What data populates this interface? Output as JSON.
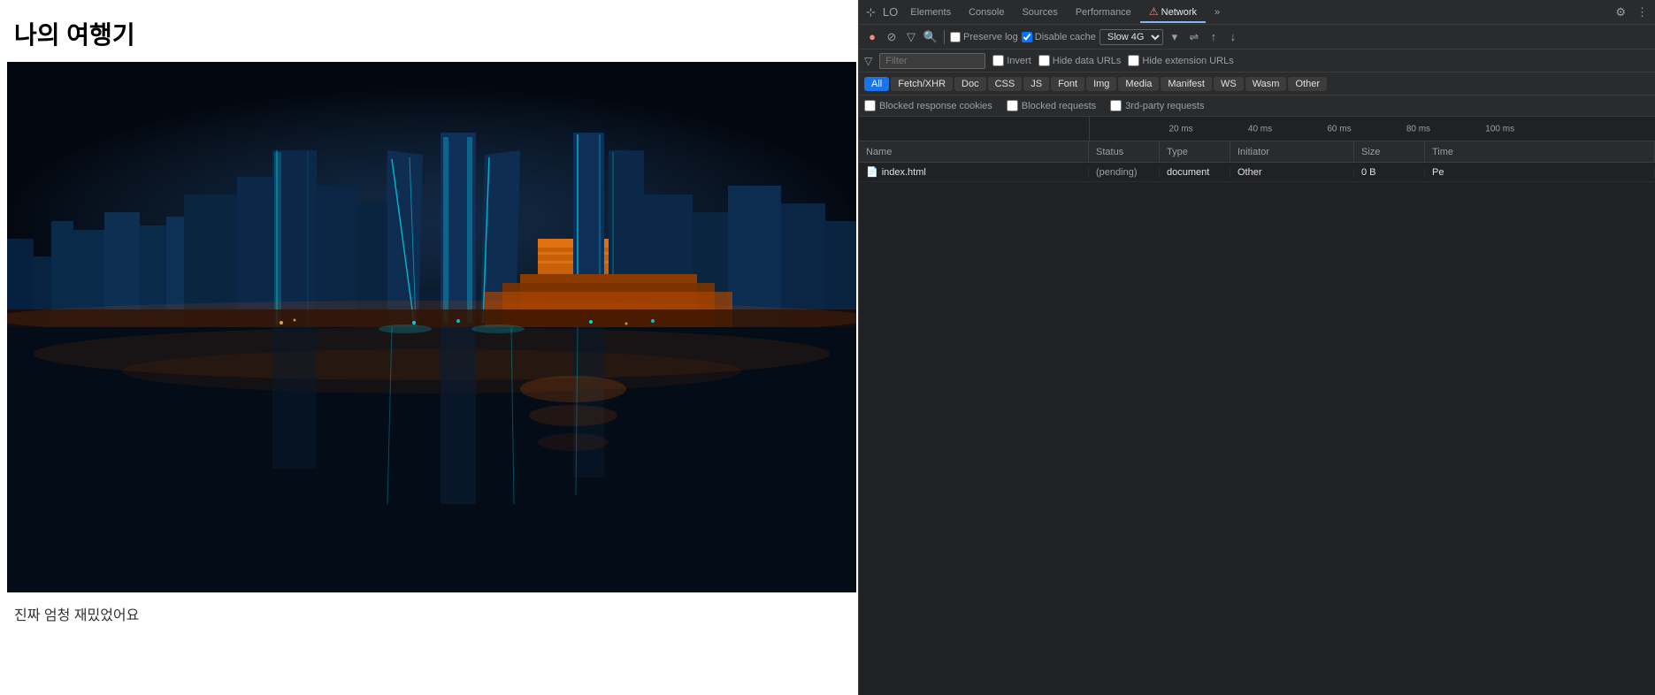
{
  "webpage": {
    "title": "나의 여행기",
    "caption": "진짜 엄청 재밌었어요"
  },
  "devtools": {
    "tabs": [
      {
        "id": "cursor",
        "label": "⊹",
        "icon": true
      },
      {
        "id": "lo",
        "label": "LO",
        "icon": false
      },
      {
        "id": "elements",
        "label": "Elements"
      },
      {
        "id": "console",
        "label": "Console"
      },
      {
        "id": "sources",
        "label": "Sources"
      },
      {
        "id": "performance",
        "label": "Performance"
      },
      {
        "id": "network",
        "label": "Network",
        "active": true
      },
      {
        "id": "more",
        "label": "»"
      }
    ],
    "toolbar": {
      "record_label": "●",
      "stop_label": "⊘",
      "filter_label": "▽",
      "search_label": "🔍",
      "preserve_log": "Preserve log",
      "disable_cache": "Disable cache",
      "throttle": "Slow 4G",
      "upload_icon": "↑",
      "download_icon": "↓",
      "wifi_icon": "⇌",
      "dropdown_icon": "▾"
    },
    "filter_bar": {
      "placeholder": "Filter",
      "invert_label": "Invert",
      "hide_data_urls_label": "Hide data URLs",
      "hide_extension_urls_label": "Hide extension URLs"
    },
    "type_filters": [
      {
        "id": "all",
        "label": "All",
        "active": true
      },
      {
        "id": "fetch_xhr",
        "label": "Fetch/XHR"
      },
      {
        "id": "doc",
        "label": "Doc"
      },
      {
        "id": "css",
        "label": "CSS"
      },
      {
        "id": "js",
        "label": "JS"
      },
      {
        "id": "font",
        "label": "Font"
      },
      {
        "id": "img",
        "label": "Img"
      },
      {
        "id": "media",
        "label": "Media"
      },
      {
        "id": "manifest",
        "label": "Manifest"
      },
      {
        "id": "ws",
        "label": "WS"
      },
      {
        "id": "wasm",
        "label": "Wasm"
      },
      {
        "id": "other",
        "label": "Other"
      }
    ],
    "extra_filters": [
      {
        "id": "blocked_cookies",
        "label": "Blocked response cookies"
      },
      {
        "id": "blocked_requests",
        "label": "Blocked requests"
      },
      {
        "id": "third_party",
        "label": "3rd-party requests"
      }
    ],
    "timeline": {
      "ticks": [
        {
          "label": "20 ms",
          "position": "14%"
        },
        {
          "label": "40 ms",
          "position": "28%"
        },
        {
          "label": "60 ms",
          "position": "42%"
        },
        {
          "label": "80 ms",
          "position": "56%"
        },
        {
          "label": "100 ms",
          "position": "70%"
        }
      ]
    },
    "table": {
      "columns": [
        {
          "id": "name",
          "label": "Name"
        },
        {
          "id": "status",
          "label": "Status"
        },
        {
          "id": "type",
          "label": "Type"
        },
        {
          "id": "initiator",
          "label": "Initiator"
        },
        {
          "id": "size",
          "label": "Size"
        },
        {
          "id": "time",
          "label": "Time"
        }
      ],
      "rows": [
        {
          "name": "index.html",
          "status": "(pending)",
          "type": "document",
          "initiator": "Other",
          "size": "0 B",
          "time": "Pe"
        }
      ]
    },
    "settings_icons": [
      "⚙",
      "⋮"
    ]
  }
}
